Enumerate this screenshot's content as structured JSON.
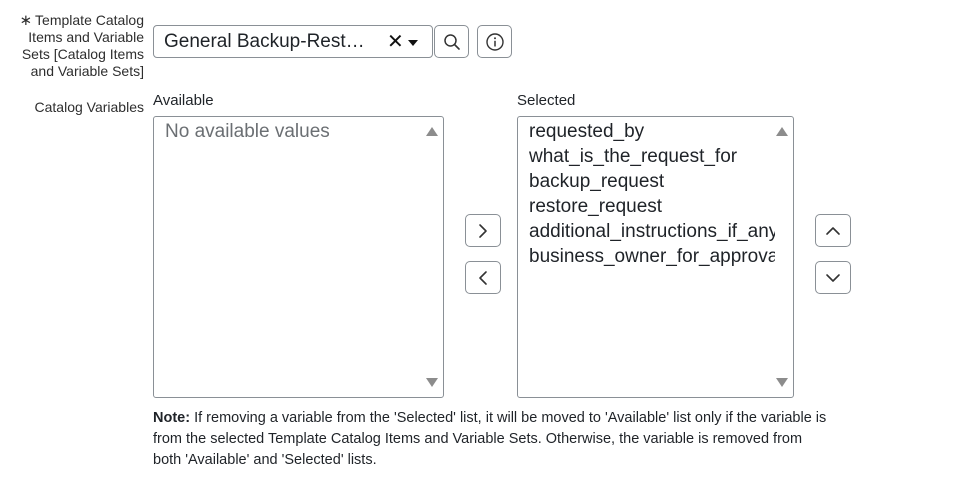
{
  "field": {
    "required_mark": "∗",
    "label": "Template Catalog Items and Variable Sets [Catalog Items and Variable Sets]",
    "value": "General Backup-Restore Request",
    "display_value": "General Backup-Restor..."
  },
  "variables": {
    "label": "Catalog Variables",
    "available_label": "Available",
    "available_placeholder": "No available values",
    "selected_label": "Selected",
    "selected_items": [
      "requested_by",
      "what_is_the_request_for",
      "backup_request",
      "restore_request",
      "additional_instructions_if_any",
      "business_owner_for_approval"
    ]
  },
  "note": {
    "prefix": "Note:",
    "text": " If removing a variable from the 'Selected' list, it will be moved to 'Available' list only if the variable is from the selected Template Catalog Items and Variable Sets. Otherwise, the variable is removed from both 'Available' and 'Selected' lists."
  },
  "icons": {
    "clear": "close-icon",
    "dropdown": "chevron-down-icon",
    "lookup": "search-icon",
    "info": "info-icon",
    "add": "chevron-right-icon",
    "remove": "chevron-left-icon",
    "move_up": "chevron-up-icon",
    "move_down": "chevron-down-icon"
  }
}
